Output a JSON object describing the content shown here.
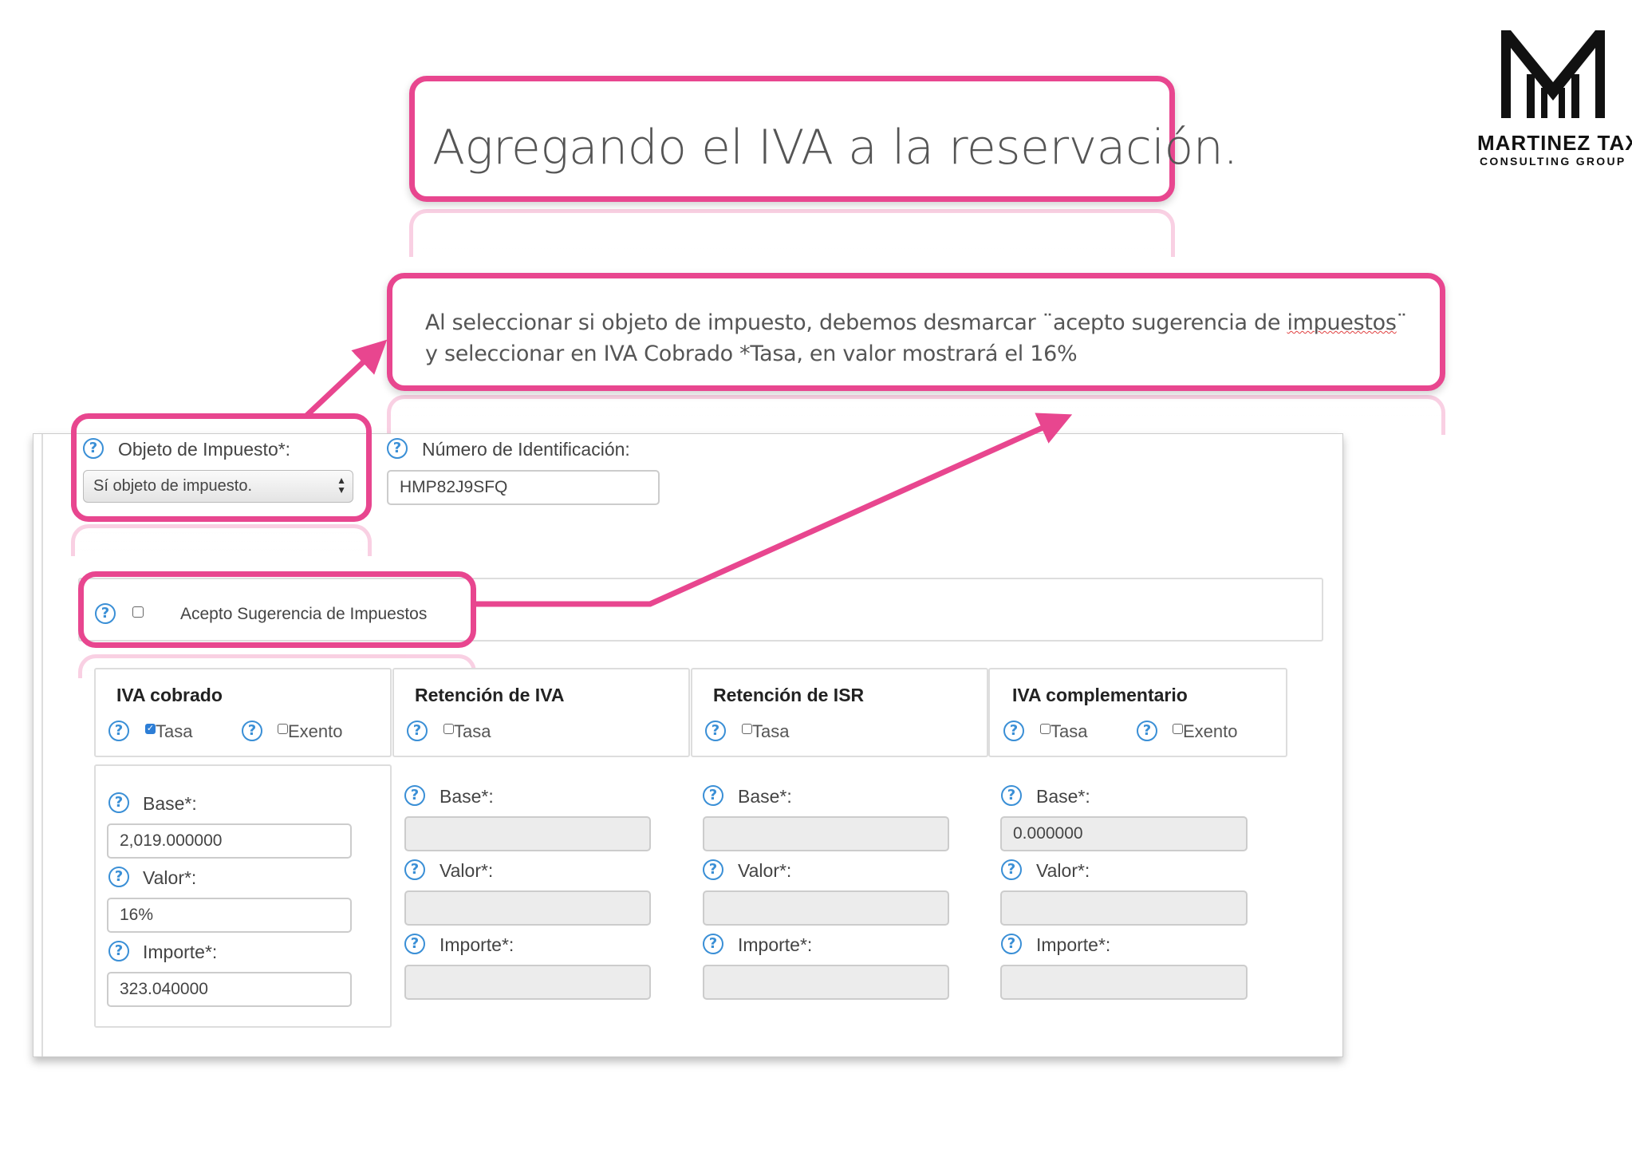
{
  "slide": {
    "title": "Agregando el IVA a la reservación.",
    "callout_line1_a": "Al seleccionar si objeto de impuesto, debemos desmarcar ¨acepto sugerencia de ",
    "callout_line1_b": "impuestos",
    "callout_line1_c": "¨",
    "callout_line2": "y seleccionar  en IVA Cobrado *Tasa, en valor mostrará el 16%",
    "accent_color": "#e8468f"
  },
  "logo": {
    "line1": "MARTINEZ TAX",
    "line2": "CONSULTING GROUP"
  },
  "form": {
    "objeto_label": "Objeto de Impuesto*:",
    "objeto_value": "Sí objeto de impuesto.",
    "numero_label": "Número de Identificación:",
    "numero_value": "HMP82J9SFQ",
    "acepto_label": "Acepto Sugerencia de Impuestos",
    "acepto_checked": false,
    "help_icon": "question-circle-icon",
    "sections": [
      {
        "title": "IVA cobrado",
        "opt1": "Tasa",
        "opt1_checked": true,
        "opt2": "Exento",
        "opt2_checked": false,
        "base_label": "Base*:",
        "base_value": "2,019.000000",
        "valor_label": "Valor*:",
        "valor_value": "16%",
        "importe_label": "Importe*:",
        "importe_value": "323.040000"
      },
      {
        "title": "Retención de IVA",
        "opt1": "Tasa",
        "opt1_checked": false,
        "base_label": "Base*:",
        "base_value": "",
        "valor_label": "Valor*:",
        "valor_value": "",
        "importe_label": "Importe*:",
        "importe_value": ""
      },
      {
        "title": "Retención de ISR",
        "opt1": "Tasa",
        "opt1_checked": false,
        "base_label": "Base*:",
        "base_value": "",
        "valor_label": "Valor*:",
        "valor_value": "",
        "importe_label": "Importe*:",
        "importe_value": ""
      },
      {
        "title": "IVA complementario",
        "opt1": "Tasa",
        "opt1_checked": false,
        "opt2": "Exento",
        "opt2_checked": false,
        "base_label": "Base*:",
        "base_value": "0.000000",
        "valor_label": "Valor*:",
        "valor_value": "",
        "importe_label": "Importe*:",
        "importe_value": ""
      }
    ]
  }
}
